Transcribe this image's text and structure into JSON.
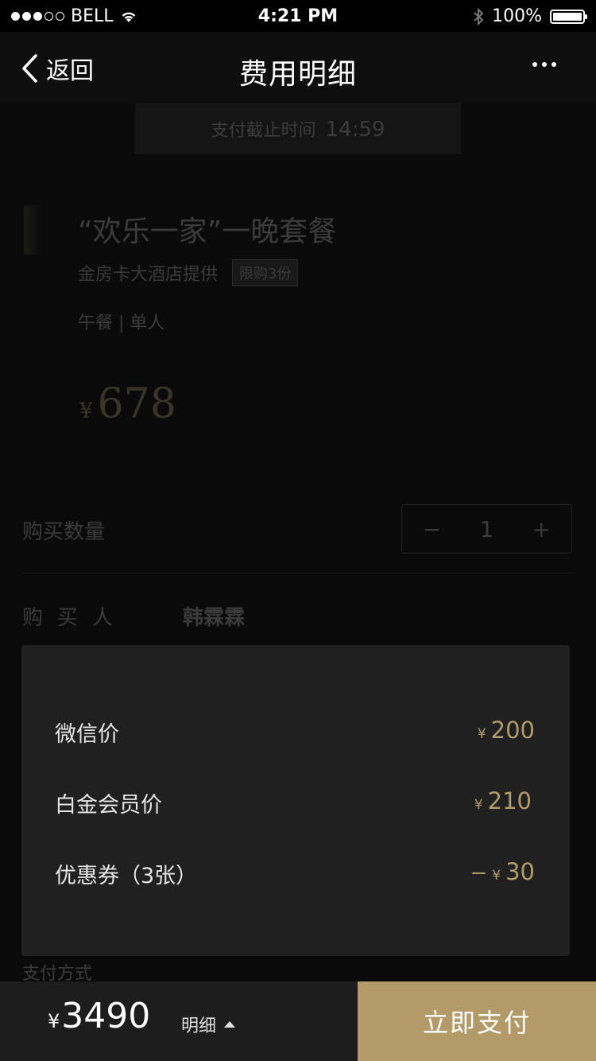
{
  "status_bar": {
    "carrier": "BELL",
    "time": "4:21 PM",
    "battery": "100%"
  },
  "nav": {
    "back_label": "返回",
    "title": "费用明细"
  },
  "order": {
    "deadline_label": "支付截止时间",
    "deadline_time": "14:59",
    "package_title": "“欢乐一家”一晚套餐",
    "provider": "金房卡大酒店提供",
    "limit_tag": "限购3份",
    "meal_info": "午餐 | 单人",
    "price_currency": "¥",
    "price_value": "678",
    "quantity_label": "购买数量",
    "quantity_minus": "−",
    "quantity_value": "1",
    "quantity_plus": "+",
    "buyer_label": "购买人",
    "buyer_name": "韩霖霖",
    "payment_method_label": "支付方式"
  },
  "breakdown": {
    "rows": [
      {
        "label": "微信价",
        "currency": "¥",
        "amount": "200"
      },
      {
        "label": "白金会员价",
        "currency": "¥",
        "amount": "210"
      },
      {
        "label": "优惠券（3张）",
        "minus": "−",
        "currency": "¥",
        "amount": "30"
      }
    ]
  },
  "bottom_bar": {
    "currency": "¥",
    "total": "3490",
    "detail_label": "明细",
    "pay_button": "立即支付"
  },
  "colors": {
    "accent": "#b39b69",
    "popup_bg": "#202020",
    "bottom_bg": "#1d1d1d"
  }
}
